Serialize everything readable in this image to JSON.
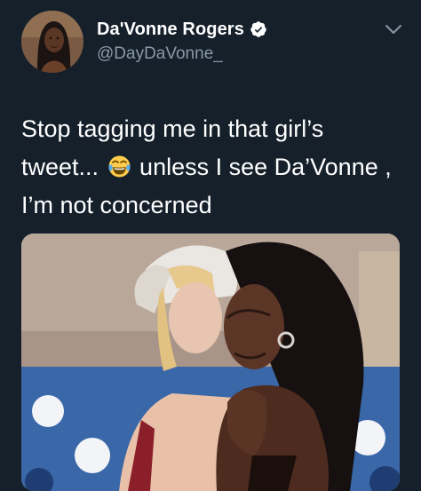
{
  "tweet": {
    "display_name": "Da'Vonne Rogers",
    "handle": "@DayDaVonne_",
    "verified_icon": "verified-badge-icon",
    "menu_icon": "chevron-down-icon",
    "text_before_emoji": "Stop tagging me in that girl’s tweet...",
    "emoji": "face-with-tears-of-joy-icon",
    "text_after_emoji": "unless I see Da’Vonne , I’m not concerned",
    "media_type": "animated-gif-image"
  },
  "colors": {
    "background": "#15202b",
    "primary_text": "#ffffff",
    "secondary_text": "#8899a6",
    "verified": "#ffffff"
  }
}
